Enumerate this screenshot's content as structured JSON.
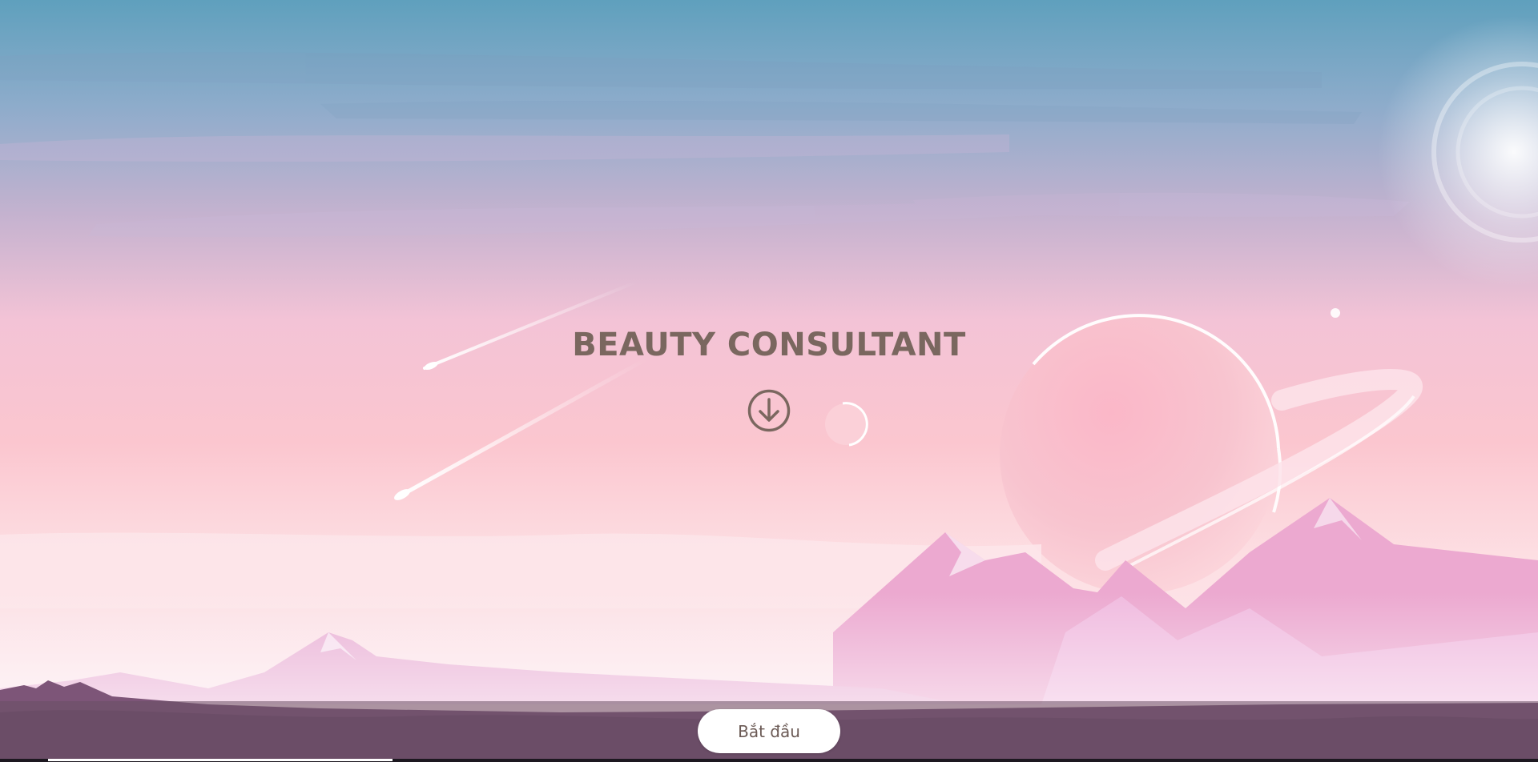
{
  "hero": {
    "title": "BEAUTY CONSULTANT",
    "scroll_icon": "arrow-down-circle-icon"
  },
  "footer": {
    "start_label": "Bắt đầu"
  },
  "progress": {
    "fraction": 0.18
  },
  "colors": {
    "title": "#7a675f",
    "sky_top": "#5fa0bd",
    "sky_pink": "#f9c2cd",
    "mountain": "#e9a6cf",
    "bar": "#6a5064",
    "button_bg": "#ffffff",
    "button_text": "#6b5a55"
  }
}
